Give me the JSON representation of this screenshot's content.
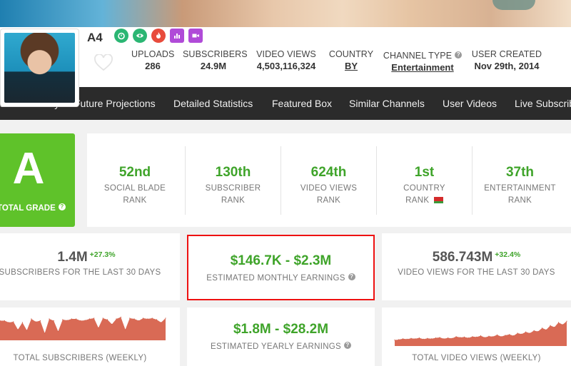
{
  "channel": {
    "name": "A4",
    "badges": [
      {
        "icon": "timer-icon",
        "color": "#2bb673"
      },
      {
        "icon": "eye-icon",
        "color": "#2bb673"
      },
      {
        "icon": "flame-icon",
        "color": "#e84b3c"
      },
      {
        "icon": "bar-chart-icon",
        "color": "#b04bd8"
      },
      {
        "icon": "video-camera-icon",
        "color": "#b04bd8"
      }
    ]
  },
  "header_stats": {
    "uploads": {
      "label": "UPLOADS",
      "value": "286"
    },
    "subscribers": {
      "label": "SUBSCRIBERS",
      "value": "24.9M"
    },
    "video_views": {
      "label": "VIDEO VIEWS",
      "value": "4,503,116,324"
    },
    "country": {
      "label": "COUNTRY",
      "value": "BY"
    },
    "channel_type": {
      "label": "CHANNEL TYPE",
      "value": "Entertainment"
    },
    "user_created": {
      "label": "USER CREATED",
      "value": "Nov 29th, 2014"
    }
  },
  "nav": [
    "ser Summary",
    "Future Projections",
    "Detailed Statistics",
    "Featured Box",
    "Similar Channels",
    "User Videos",
    "Live Subscrib"
  ],
  "grade": {
    "letter": "A",
    "label": "TOTAL GRADE"
  },
  "ranks": [
    {
      "value": "52nd",
      "line1": "SOCIAL BLADE",
      "line2": "RANK"
    },
    {
      "value": "130th",
      "line1": "SUBSCRIBER",
      "line2": "RANK"
    },
    {
      "value": "624th",
      "line1": "VIDEO VIEWS",
      "line2": "RANK"
    },
    {
      "value": "1st",
      "line1": "COUNTRY",
      "line2": "RANK"
    },
    {
      "value": "37th",
      "line1": "ENTERTAINMENT",
      "line2": "RANK"
    }
  ],
  "cards": {
    "subs30": {
      "value": "1.4M",
      "change": "+27.3%",
      "label": "SUBSCRIBERS FOR THE LAST 30 DAYS"
    },
    "monthly": {
      "value": "$146.7K - $2.3M",
      "label": "ESTIMATED MONTHLY EARNINGS"
    },
    "views30": {
      "value": "586.743M",
      "change": "+32.4%",
      "label": "VIDEO VIEWS FOR THE LAST 30 DAYS"
    },
    "yearly": {
      "value": "$1.8M - $28.2M",
      "label": "ESTIMATED YEARLY EARNINGS"
    }
  },
  "colors": {
    "accent_green": "#3fa42a",
    "grade_green": "#5fc22a",
    "chart_fill": "#d96a55",
    "highlight_red": "#ee1111",
    "nav_bg": "#2b2b2b"
  },
  "chart_data": [
    {
      "type": "area",
      "title": "TOTAL SUBSCRIBERS (WEEKLY)",
      "values": [
        55,
        55,
        50,
        52,
        30,
        50,
        28,
        60,
        52,
        55,
        20,
        60,
        55,
        25,
        58,
        56,
        60,
        60,
        55,
        56,
        60,
        62,
        35,
        62,
        58,
        45,
        60,
        65,
        30,
        62,
        60,
        55,
        62,
        60,
        62,
        58,
        50,
        62
      ],
      "ylim": [
        0,
        80
      ]
    },
    {
      "type": "area",
      "title": "TOTAL VIDEO VIEWS (WEEKLY)",
      "values": [
        14,
        15,
        17,
        16,
        18,
        17,
        19,
        16,
        18,
        17,
        19,
        20,
        17,
        19,
        18,
        22,
        20,
        21,
        19,
        22,
        21,
        24,
        20,
        23,
        22,
        26,
        22,
        25,
        27,
        24,
        30,
        28,
        33,
        30,
        36,
        34,
        42,
        38,
        48,
        44,
        55,
        50,
        58
      ],
      "ylim": [
        0,
        80
      ]
    }
  ]
}
